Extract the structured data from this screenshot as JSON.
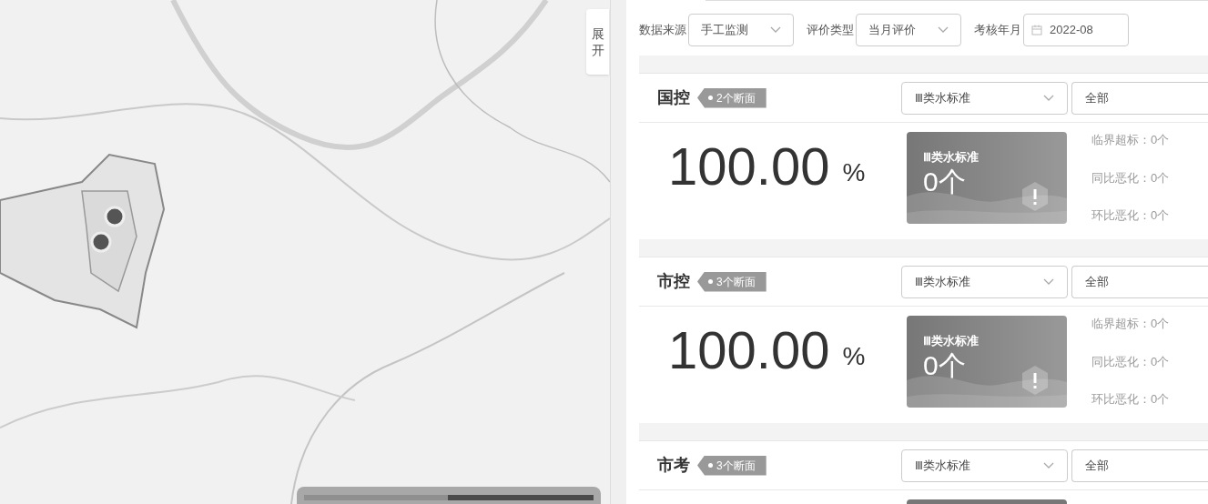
{
  "side_tab": {
    "label": "展开"
  },
  "filters": [
    {
      "kind": "select",
      "label": "数据来源",
      "value": "手工监测"
    },
    {
      "kind": "select",
      "label": "评价类型",
      "value": "当月评价"
    },
    {
      "kind": "date",
      "label": "考核年月",
      "value": "2022-08"
    }
  ],
  "sections": [
    {
      "title": "国控",
      "badge": "2个断面",
      "standard": "Ⅲ类水标准",
      "scope": "全部",
      "rate": "100.00",
      "unit": "%",
      "card": {
        "label": "Ⅲ类水标准",
        "count": "0个"
      },
      "stats": [
        "临界超标：0个",
        "同比恶化：0个",
        "环比恶化：0个"
      ]
    },
    {
      "title": "市控",
      "badge": "3个断面",
      "standard": "Ⅲ类水标准",
      "scope": "全部",
      "rate": "100.00",
      "unit": "%",
      "card": {
        "label": "Ⅲ类水标准",
        "count": "0个"
      },
      "stats": [
        "临界超标：0个",
        "同比恶化：0个",
        "环比恶化：0个"
      ]
    },
    {
      "title": "市考",
      "badge": "3个断面",
      "standard": "Ⅲ类水标准",
      "scope": "全部"
    }
  ]
}
